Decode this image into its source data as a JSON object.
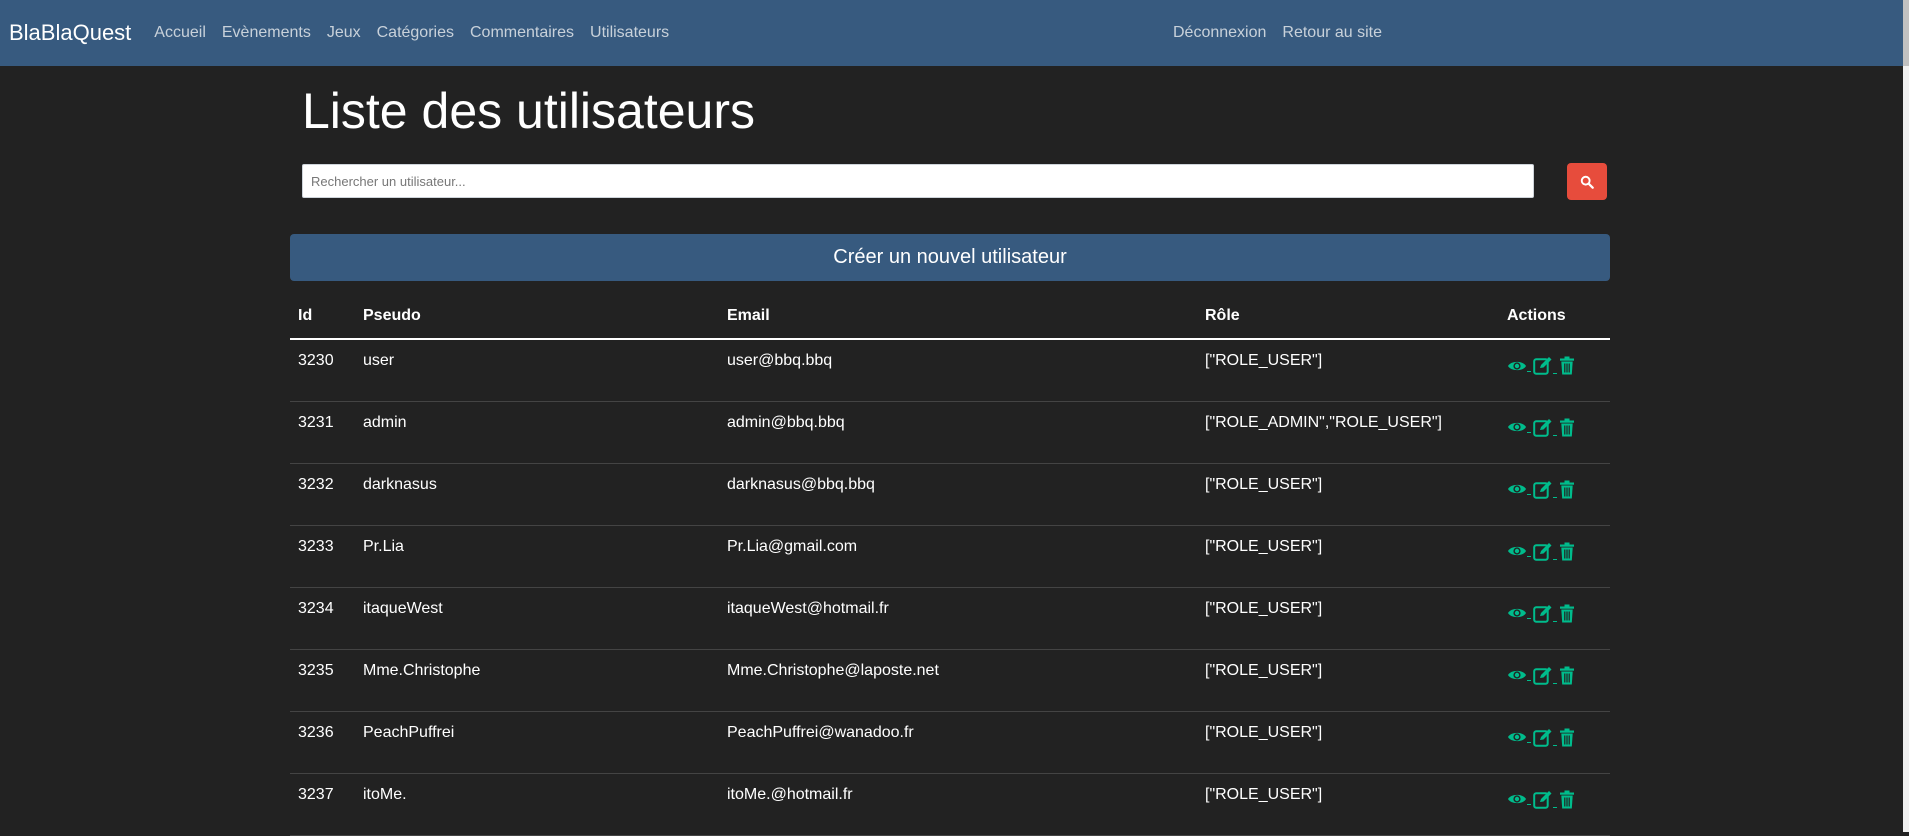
{
  "navbar": {
    "brand": "BlaBlaQuest",
    "links": [
      "Accueil",
      "Evènements",
      "Jeux",
      "Catégories",
      "Commentaires",
      "Utilisateurs"
    ],
    "right_links": [
      "Déconnexion",
      "Retour au site"
    ],
    "background": "#375a7f"
  },
  "page": {
    "title": "Liste des utilisateurs"
  },
  "search": {
    "placeholder": "Rechercher un utilisateur...",
    "value": "",
    "button_icon": "search-icon",
    "button_color": "#e74c3c"
  },
  "create_button": {
    "label": "Créer un nouvel utilisateur"
  },
  "table": {
    "headers": [
      "Id",
      "Pseudo",
      "Email",
      "Rôle",
      "Actions"
    ],
    "rows": [
      {
        "id": "3230",
        "pseudo": "user",
        "email": "user@bbq.bbq",
        "role": "[\"ROLE_USER\"]"
      },
      {
        "id": "3231",
        "pseudo": "admin",
        "email": "admin@bbq.bbq",
        "role": "[\"ROLE_ADMIN\",\"ROLE_USER\"]"
      },
      {
        "id": "3232",
        "pseudo": "darknasus",
        "email": "darknasus@bbq.bbq",
        "role": "[\"ROLE_USER\"]"
      },
      {
        "id": "3233",
        "pseudo": "Pr.Lia",
        "email": "Pr.Lia@gmail.com",
        "role": "[\"ROLE_USER\"]"
      },
      {
        "id": "3234",
        "pseudo": "itaqueWest",
        "email": "itaqueWest@hotmail.fr",
        "role": "[\"ROLE_USER\"]"
      },
      {
        "id": "3235",
        "pseudo": "Mme.Christophe",
        "email": "Mme.Christophe@laposte.net",
        "role": "[\"ROLE_USER\"]"
      },
      {
        "id": "3236",
        "pseudo": "PeachPuffrei",
        "email": "PeachPuffrei@wanadoo.fr",
        "role": "[\"ROLE_USER\"]"
      },
      {
        "id": "3237",
        "pseudo": "itoMe.",
        "email": "itoMe.@hotmail.fr",
        "role": "[\"ROLE_USER\"]"
      }
    ],
    "action_icons": [
      "eye-icon",
      "edit-icon",
      "trash-icon"
    ],
    "action_color": "#00bc8c"
  }
}
